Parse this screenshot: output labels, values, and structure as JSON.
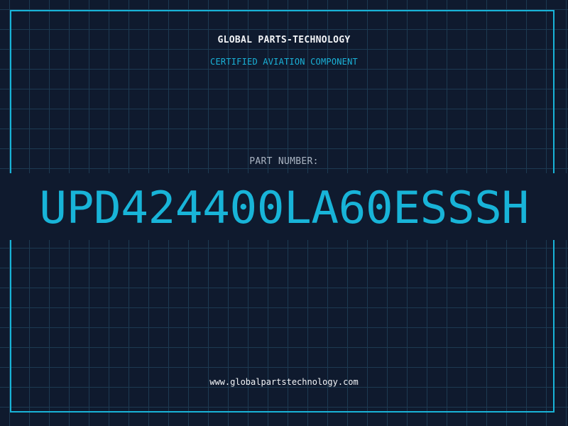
{
  "header": {
    "company": "GLOBAL PARTS-TECHNOLOGY",
    "subtitle": "CERTIFIED AVIATION COMPONENT"
  },
  "part": {
    "label": "PART NUMBER:",
    "number": "UPD424400LA60ESSSH"
  },
  "footer": {
    "website": "www.globalpartstechnology.com"
  },
  "colors": {
    "background": "#0f1a2e",
    "grid": "#1d3a52",
    "accent": "#18b4d8",
    "text": "#f2f4f7",
    "muted": "#aab4c2"
  }
}
